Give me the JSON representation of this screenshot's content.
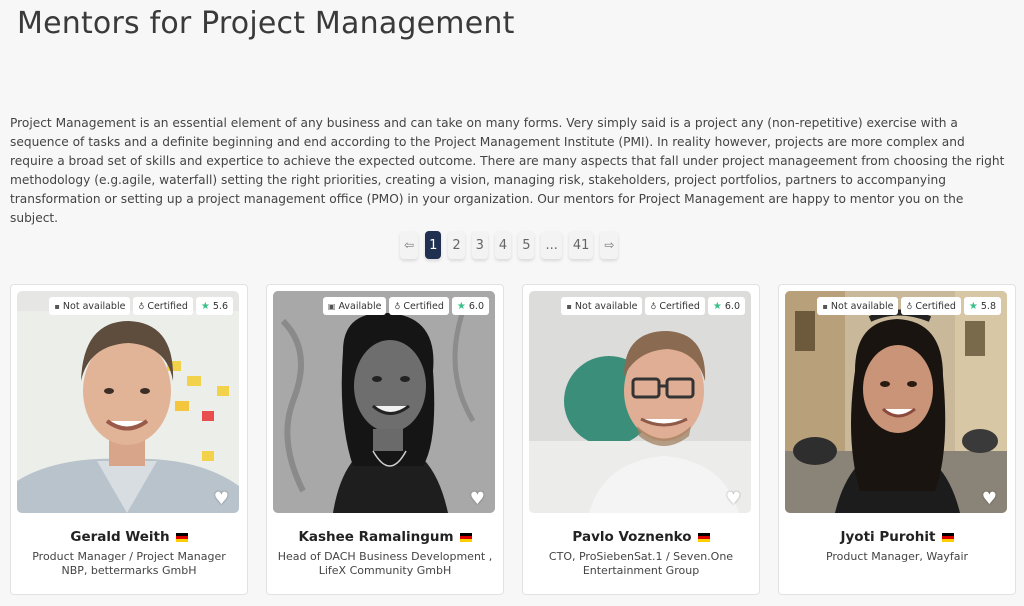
{
  "page": {
    "title": "Mentors for Project Management",
    "intro": "Project Management is an essential element of any business and can take on many forms. Very simply said is a project any (non-repetitive) exercise with a sequence of tasks and a definite beginning and end according to the Project Management Institute (PMI). In reality however, projects are more complex and require a broad set of skills and expertice to achieve the expected outcome. There are many aspects that fall under project manageement from choosing the right methodology (e.g.agile, waterfall) setting the right priorities, creating a vision, managing risk, stakeholders, project portfolios, partners to accompanying transformation or setting up a project management office (PMO) in your organization. Our mentors for Project Management are happy to mentor you on the subject."
  },
  "pagination": {
    "prev": "⇦",
    "next": "⇨",
    "pages": [
      "1",
      "2",
      "3",
      "4",
      "5",
      "...",
      "41"
    ],
    "active": "1"
  },
  "colors": {
    "active_page": "#1f3050",
    "rating_star": "#39c08a"
  },
  "mentors": [
    {
      "name": "Gerald Weith",
      "flag": "germany-flag",
      "role": "Product Manager / Project Manager NBP, bettermarks GmbH",
      "availability": "Not available",
      "certified": "Certified",
      "rating": "5.6"
    },
    {
      "name": "Kashee Ramalingum",
      "flag": "germany-flag",
      "role": "Head of DACH Business Development , LifeX Community GmbH",
      "availability": "Available",
      "certified": "Certified",
      "rating": "6.0"
    },
    {
      "name": "Pavlo Voznenko",
      "flag": "germany-flag",
      "role": "CTO, ProSiebenSat.1 / Seven.One Entertainment Group",
      "availability": "Not available",
      "certified": "Certified",
      "rating": "6.0"
    },
    {
      "name": "Jyoti Purohit",
      "flag": "germany-flag",
      "role": "Product Manager, Wayfair",
      "availability": "Not available",
      "certified": "Certified",
      "rating": "5.8"
    }
  ]
}
